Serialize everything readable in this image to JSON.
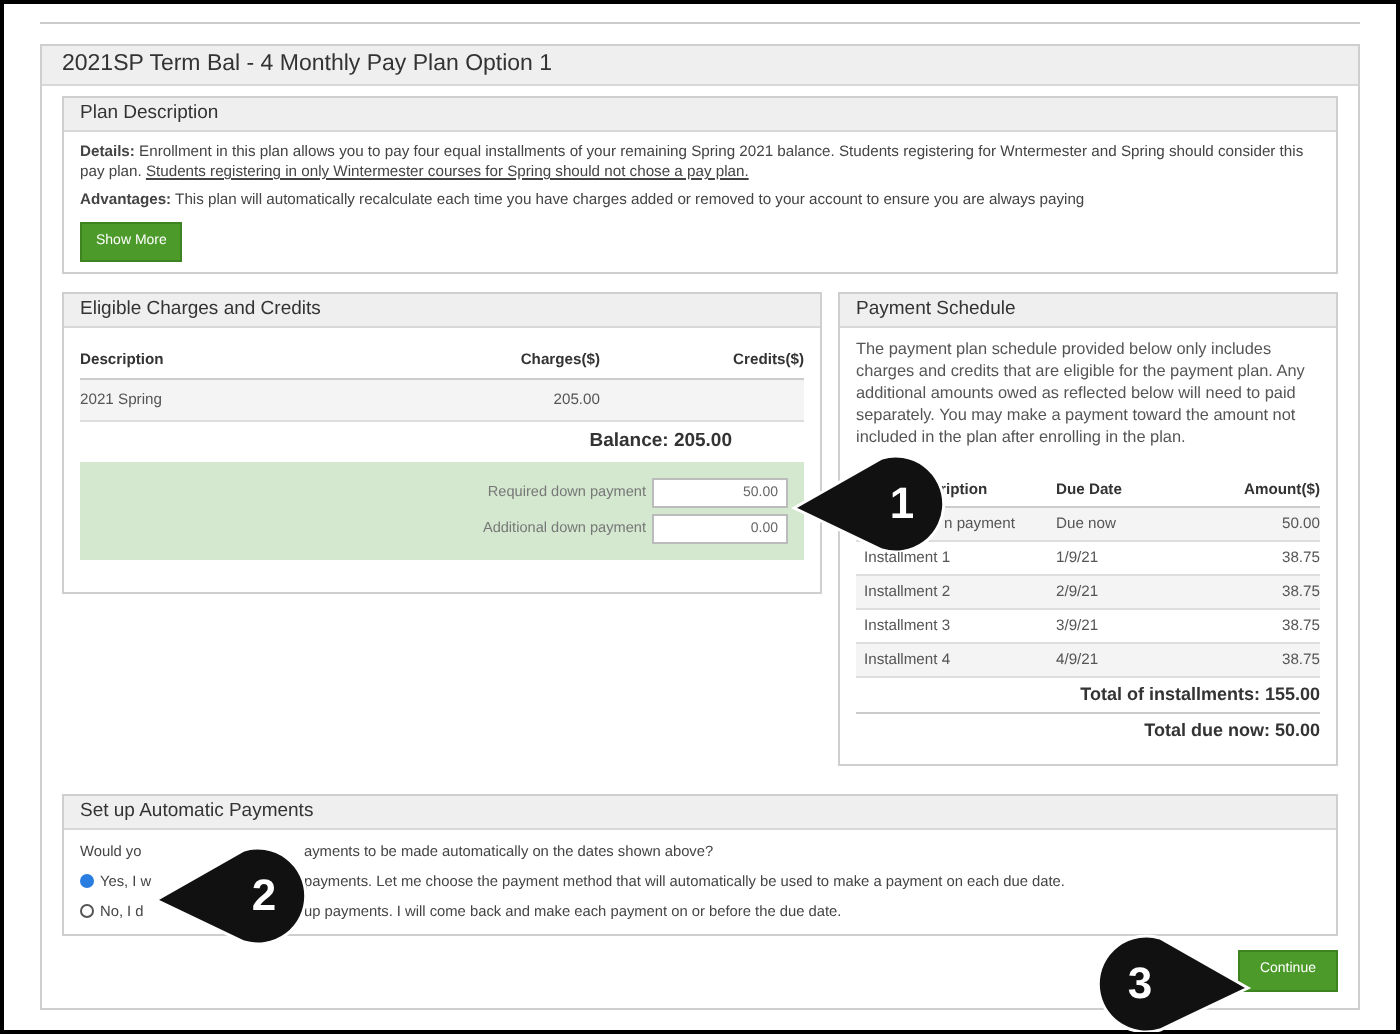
{
  "plan": {
    "title": "2021SP Term Bal - 4 Monthly Pay Plan Option 1"
  },
  "plan_description": {
    "title": "Plan Description",
    "details": "**Details:** Enrollment in this plan allows you to pay four equal installments of your remaining Spring  2021 balance.  Students registering for Wntermester and Spring should consider this pay plan.",
    "details_underlined": "Students registering in only Wintermester courses for Spring should not chose a pay plan.",
    "advantages": "**Advantages:** This plan will automatically recalculate each time you have charges added or removed to your account to ensure you are always paying",
    "show_more": "Show More"
  },
  "eligible": {
    "title": "Eligible Charges and Credits",
    "columns": [
      "Description",
      "Charges($)",
      "Credits($)"
    ],
    "rows": [
      {
        "description": "2021 Spring",
        "charges": "205.00"
      }
    ],
    "balance": "Balance: 205.00",
    "down_payments": [
      {
        "label": "Required down payment",
        "value": "50.00"
      },
      {
        "label": "Additional down payment",
        "value": "0.00"
      }
    ]
  },
  "schedule": {
    "title": "Payment Schedule",
    "intro": "The payment plan schedule provided below only includes charges and credits that are eligible for the payment plan. Any additional amounts owed as reflected below will need to paid separately. You may make a payment toward the amount not included in the plan after enrolling in the plan.",
    "columns": [
      "ription",
      "Due Date",
      "Amount($)"
    ],
    "rows": [
      {
        "description": "n payment",
        "due": "Due now",
        "amount": "50.00"
      },
      {
        "description": "Installment 1",
        "due": "1/9/21",
        "amount": "38.75"
      },
      {
        "description": "Installment 2",
        "due": "2/9/21",
        "amount": "38.75"
      },
      {
        "description": "Installment 3",
        "due": "3/9/21",
        "amount": "38.75"
      },
      {
        "description": "Installment 4",
        "due": "4/9/21",
        "amount": "38.75"
      }
    ],
    "total_installments": "Total of installments: 155.00",
    "total_due": "Total due now: 50.00"
  },
  "auto_payments": {
    "title": "Set up Automatic Payments",
    "question": [
      "Would yo",
      "ayments to be made automatically on the dates shown above?"
    ],
    "options": [
      {
        "parts": [
          "Yes, I w",
          "payments. Let me choose the payment method that will automatically be used to make a payment on each due date."
        ],
        "selected": true
      },
      {
        "parts": [
          "No, I d",
          "up payments. I will come back and make each payment on or before the due date."
        ],
        "selected": false
      }
    ]
  },
  "continue": "Continue",
  "callouts": [
    {
      "number": "1"
    },
    {
      "number": "2"
    },
    {
      "number": "3"
    }
  ]
}
